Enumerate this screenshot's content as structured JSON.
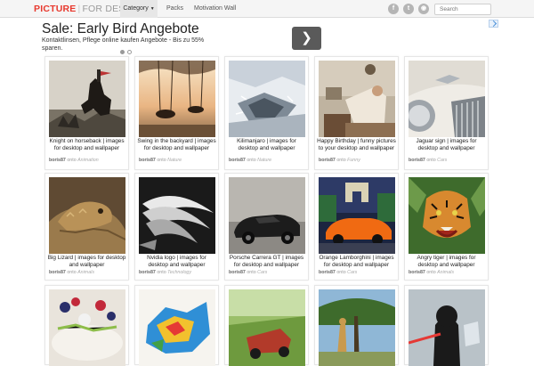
{
  "navbar": {
    "logo_part1": "PICTURE",
    "logo_sep": "|",
    "logo_part2": "FOR DESKTOP",
    "category_label": "Category",
    "packs_label": "Packs",
    "motivation_label": "Motivation Wall",
    "search_placeholder": "Search",
    "icons": [
      "facebook-icon",
      "twitter-icon",
      "rss-icon"
    ]
  },
  "ad": {
    "title": "Sale: Early Bird Angebote",
    "description": "Kontaktlinsen, Pflege online kaufen Angebote - Bis zu 55% sparen.",
    "next_glyph": "❯"
  },
  "cards": [
    {
      "caption": "Knight on horseback | images for desktop and wallpaper",
      "user": "boris87",
      "onto": "onto",
      "board": "Animation"
    },
    {
      "caption": "Swing in the backyard | images for desktop and wallpaper",
      "user": "boris87",
      "onto": "onto",
      "board": "Nature"
    },
    {
      "caption": "Kilimanjaro | images for desktop and wallpaper",
      "user": "boris87",
      "onto": "onto",
      "board": "Nature"
    },
    {
      "caption": "Happy Birthday | funny pictures to your desktop and wallpaper",
      "user": "boris87",
      "onto": "onto",
      "board": "Funny"
    },
    {
      "caption": "Jaguar sign | images for desktop and wallpaper",
      "user": "boris87",
      "onto": "onto",
      "board": "Cars"
    },
    {
      "caption": "Big Lizard | images for desktop and wallpaper",
      "user": "boris87",
      "onto": "onto",
      "board": "Animals"
    },
    {
      "caption": "Nvidia logo | images for desktop and wallpaper",
      "user": "boris87",
      "onto": "onto",
      "board": "Technology"
    },
    {
      "caption": "Porsche Carrera GT | images for desktop and wallpaper",
      "user": "boris87",
      "onto": "onto",
      "board": "Cars"
    },
    {
      "caption": "Orange Lamborghini | images for desktop and wallpaper",
      "user": "boris87",
      "onto": "onto",
      "board": "Cars"
    },
    {
      "caption": "Angry tiger | images for desktop and wallpaper",
      "user": "boris87",
      "onto": "onto",
      "board": "Animals"
    }
  ],
  "colors": {
    "logo_red": "#e8382d",
    "navbar_bg": "#f5f5f5",
    "ad_button": "#5a5a5a"
  }
}
